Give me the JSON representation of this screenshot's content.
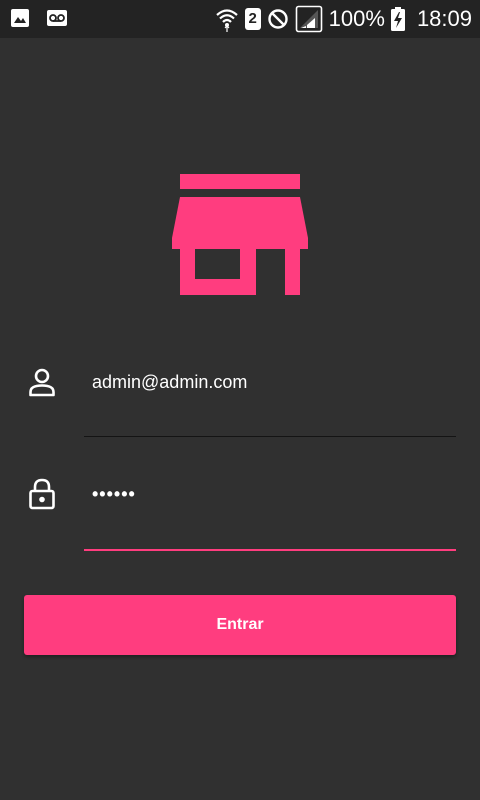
{
  "status_bar": {
    "battery": "100%",
    "time": "18:09",
    "sim_slot": "2",
    "icons": [
      "image-icon",
      "voicemail-icon",
      "wifi-icon",
      "sim-icon",
      "do-not-disturb-icon",
      "signal-icon",
      "battery-charging-icon"
    ]
  },
  "logo": {
    "icon": "store-icon",
    "color": "#ff3d7f"
  },
  "form": {
    "email": {
      "icon": "person-icon",
      "value": "admin@admin.com"
    },
    "password": {
      "icon": "lock-icon",
      "value": "••••••"
    },
    "submit_label": "Entrar"
  },
  "colors": {
    "accent": "#ff3d7f",
    "background": "#303030",
    "status_bar": "#232323"
  }
}
